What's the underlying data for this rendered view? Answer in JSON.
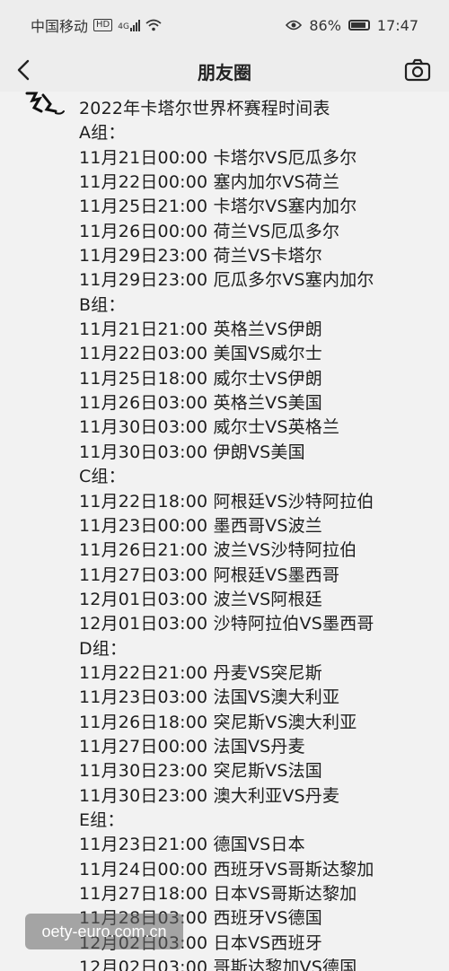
{
  "status_bar": {
    "carrier": "中国移动",
    "hd": "HD",
    "network": "4G",
    "battery": "86%",
    "time": "17:47"
  },
  "nav": {
    "title": "朋友圈"
  },
  "post": {
    "lines": [
      "2022年卡塔尔世界杯赛程时间表",
      "A组：",
      "11月21日00:00 卡塔尔VS厄瓜多尔",
      "11月22日00:00 塞内加尔VS荷兰",
      "11月25日21:00 卡塔尔VS塞内加尔",
      "11月26日00:00 荷兰VS厄瓜多尔",
      "11月29日23:00 荷兰VS卡塔尔",
      "11月29日23:00 厄瓜多尔VS塞内加尔",
      "B组：",
      "11月21日21:00 英格兰VS伊朗",
      "11月22日03:00 美国VS威尔士",
      "11月25日18:00 威尔士VS伊朗",
      "11月26日03:00 英格兰VS美国",
      "11月30日03:00 威尔士VS英格兰",
      "11月30日03:00 伊朗VS美国",
      "C组：",
      "11月22日18:00 阿根廷VS沙特阿拉伯",
      "11月23日00:00 墨西哥VS波兰",
      "11月26日21:00 波兰VS沙特阿拉伯",
      "11月27日03:00 阿根廷VS墨西哥",
      "12月01日03:00 波兰VS阿根廷",
      "12月01日03:00 沙特阿拉伯VS墨西哥",
      "D组：",
      "11月22日21:00 丹麦VS突尼斯",
      "11月23日03:00 法国VS澳大利亚",
      "11月26日18:00 突尼斯VS澳大利亚",
      "11月27日00:00 法国VS丹麦",
      "11月30日23:00 突尼斯VS法国",
      "11月30日23:00 澳大利亚VS丹麦",
      "E组：",
      "11月23日21:00 德国VS日本",
      "11月24日00:00 西班牙VS哥斯达黎加",
      "11月27日18:00 日本VS哥斯达黎加",
      "11月28日03:00 西班牙VS德国",
      "12月02日03:00 日本VS西班牙",
      "12月02日03:00 哥斯达黎加VS德国"
    ]
  },
  "watermark": "oety-euro.com.cn"
}
